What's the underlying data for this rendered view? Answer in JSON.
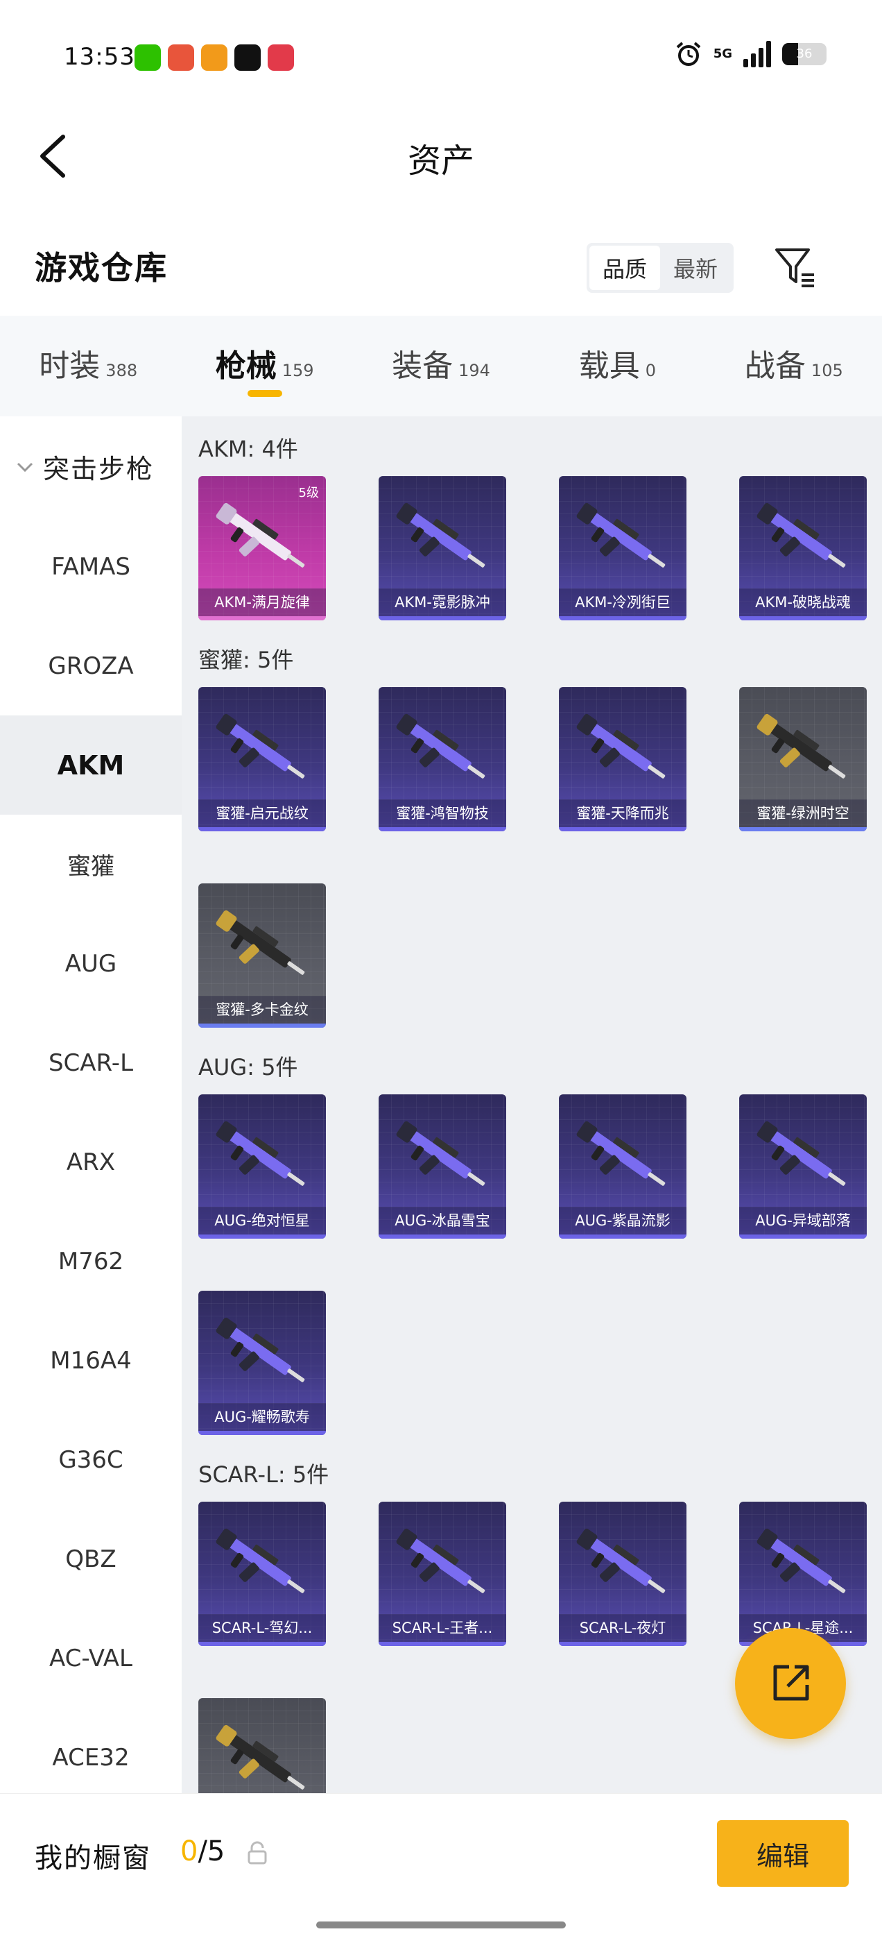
{
  "status_bar": {
    "time": "13:53",
    "network": "5G",
    "battery": "36",
    "battery_level": 0.36,
    "app_icons": [
      {
        "name": "wechat-app-icon",
        "color": "#2dc100"
      },
      {
        "name": "taobao-app-icon",
        "color": "#e8553b"
      },
      {
        "name": "video-app-icon",
        "color": "#f29a1a"
      },
      {
        "name": "green-dot-app-icon",
        "color": "#111111"
      },
      {
        "name": "shop-app-icon",
        "color": "#e23a4a"
      }
    ]
  },
  "header": {
    "title": "资产",
    "back_icon": "chevron-left-icon"
  },
  "warehouse": {
    "title": "游戏仓库",
    "sort_options": [
      "品质",
      "最新"
    ],
    "sort_active": 0,
    "filter_icon": "filter-icon"
  },
  "tabs": [
    {
      "label": "时装",
      "count": "388",
      "active": false
    },
    {
      "label": "枪械",
      "count": "159",
      "active": true
    },
    {
      "label": "装备",
      "count": "194",
      "active": false
    },
    {
      "label": "载具",
      "count": "0",
      "active": false
    },
    {
      "label": "战备",
      "count": "105",
      "active": false
    }
  ],
  "sidebar": {
    "group_label": "突击步枪",
    "items": [
      "FAMAS",
      "GROZA",
      "AKM",
      "蜜獾",
      "AUG",
      "SCAR-L",
      "ARX",
      "M762",
      "M16A4",
      "G36C",
      "QBZ",
      "AC-VAL",
      "ACE32"
    ],
    "active_index": 2
  },
  "sections": [
    {
      "title": "AKM: 4件",
      "cards": [
        {
          "label": "AKM-满月旋律",
          "style": "pink",
          "level": "5级"
        },
        {
          "label": "AKM-霓影脉冲",
          "style": "purple"
        },
        {
          "label": "AKM-冷冽街巨",
          "style": "purple"
        },
        {
          "label": "AKM-破晓战魂",
          "style": "purple"
        }
      ]
    },
    {
      "title": "蜜獾: 5件",
      "cards": [
        {
          "label": "蜜獾-启元战纹",
          "style": "purple"
        },
        {
          "label": "蜜獾-鸿智物技",
          "style": "purple"
        },
        {
          "label": "蜜獾-天降而兆",
          "style": "purple"
        },
        {
          "label": "蜜獾-绿洲时空",
          "style": "gray"
        },
        {
          "label": "蜜獾-多卡金纹",
          "style": "gray"
        }
      ]
    },
    {
      "title": "AUG: 5件",
      "cards": [
        {
          "label": "AUG-绝对恒星",
          "style": "purple"
        },
        {
          "label": "AUG-冰晶雪宝",
          "style": "purple"
        },
        {
          "label": "AUG-紫晶流影",
          "style": "purple"
        },
        {
          "label": "AUG-异域部落",
          "style": "purple"
        },
        {
          "label": "AUG-耀畅歌寿",
          "style": "purple"
        }
      ]
    },
    {
      "title": "SCAR-L: 5件",
      "cards": [
        {
          "label": "SCAR-L-驾幻...",
          "style": "purple"
        },
        {
          "label": "SCAR-L-王者...",
          "style": "purple"
        },
        {
          "label": "SCAR-L-夜灯",
          "style": "purple"
        },
        {
          "label": "SCAR-L-星途...",
          "style": "purple"
        },
        {
          "label": "",
          "style": "gray"
        }
      ]
    }
  ],
  "share_icon": "share-external-icon",
  "bottom_bar": {
    "showcase_label": "我的橱窗",
    "showcase_current": "0",
    "showcase_total": "/5",
    "edit_label": "编辑"
  },
  "colors": {
    "accent": "#f7b21a",
    "tab_indicator": "#f7b500",
    "card_purple": "#3f3880",
    "card_pink": "#c03ba8",
    "card_gray": "#5b5d66"
  }
}
